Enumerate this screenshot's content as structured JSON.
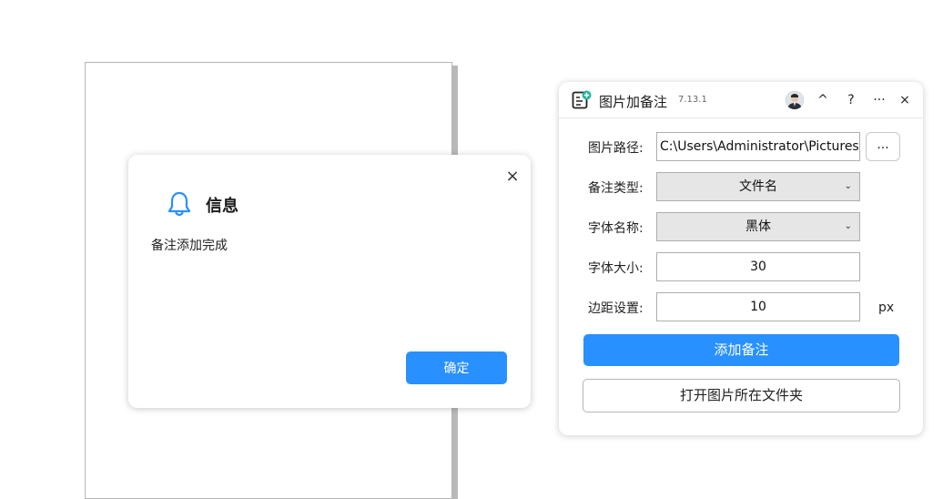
{
  "dialog": {
    "title": "信息",
    "message": "备注添加完成",
    "ok_label": "确定",
    "close_glyph": "×",
    "icon": "bell-icon",
    "accent_color": "#2990ff"
  },
  "panel": {
    "app_title": "图片加备注",
    "version": "7.13.1",
    "titlebar_buttons": {
      "collapse": "^",
      "help": "?",
      "more": "···",
      "close": "×"
    },
    "fields": {
      "path_label": "图片路径:",
      "path_value": "C:\\Users\\Administrator\\Pictures",
      "browse_label": "...",
      "note_type_label": "备注类型:",
      "note_type_value": "文件名",
      "font_name_label": "字体名称:",
      "font_name_value": "黑体",
      "font_size_label": "字体大小:",
      "font_size_value": "30",
      "margin_label": "边距设置:",
      "margin_value": "10",
      "margin_unit": "px"
    },
    "add_note_button": "添加备注",
    "open_folder_button": "打开图片所在文件夹",
    "primary_color": "#2990ff"
  }
}
